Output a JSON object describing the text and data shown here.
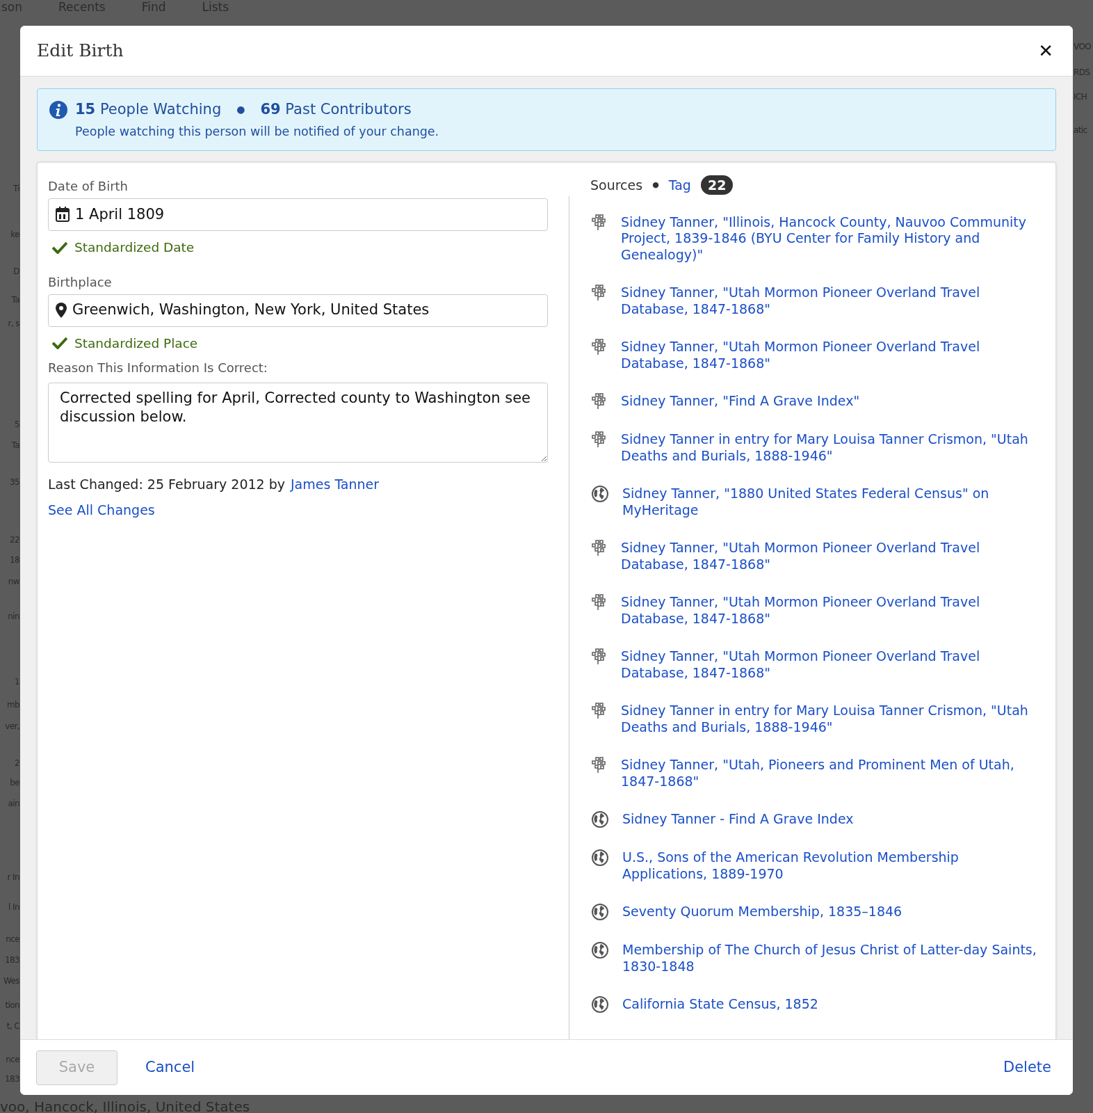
{
  "backdrop": {
    "nav": [
      "son",
      "Recents",
      "Find",
      "Lists"
    ],
    "left_fragments": [
      "Ti",
      "ke",
      "D",
      "Ta",
      "r, s",
      "5",
      "Ta",
      "35",
      "22",
      "18",
      "nw",
      "nin",
      "1",
      "mb",
      "ver,",
      "2",
      "be",
      "ain",
      "r In",
      "l In",
      "nce",
      "183",
      "Wes",
      "tion",
      "t, C",
      "nce",
      "183"
    ],
    "right_fragments": [
      "VOO",
      "RDS",
      "ICH",
      "atic"
    ],
    "bottom_text": "voo, Hancock, Illinois, United States"
  },
  "dialog": {
    "title": "Edit Birth",
    "close": "✕"
  },
  "notice": {
    "separator": "●",
    "watching_count": "15",
    "watching_label": "People Watching",
    "contributors_count": "69",
    "contributors_label": "Past Contributors",
    "message": "People watching this person will be notified of your change."
  },
  "date": {
    "label": "Date of Birth",
    "value": "1 April 1809",
    "status": "Standardized Date",
    "standardized": true
  },
  "place": {
    "label": "Birthplace",
    "value": "Greenwich, Washington, New York, United States",
    "status": "Standardized Place",
    "standardized": true
  },
  "reason": {
    "label": "Reason This Information Is Correct:",
    "value": "Corrected spelling for April, Corrected county to Washington see discussion below."
  },
  "last_changed": {
    "text": "Last Changed: 25 February 2012 by",
    "author": "James Tanner"
  },
  "see_all": "See All Changes",
  "sources_header": {
    "title": "Sources",
    "separator": "●",
    "tag": "Tag",
    "count": "22"
  },
  "sources": [
    {
      "kind": "tree",
      "text": "Sidney Tanner, \"Illinois, Hancock County, Nauvoo Community Project, 1839-1846 (BYU Center for Family History and Genealogy)\""
    },
    {
      "kind": "tree",
      "text": "Sidney Tanner, \"Utah Mormon Pioneer Overland Travel Database, 1847-1868\""
    },
    {
      "kind": "tree",
      "text": "Sidney Tanner, \"Utah Mormon Pioneer Overland Travel Database, 1847-1868\""
    },
    {
      "kind": "tree",
      "text": "Sidney Tanner, \"Find A Grave Index\""
    },
    {
      "kind": "tree",
      "text": "Sidney Tanner in entry for Mary Louisa Tanner Crismon, \"Utah Deaths and Burials, 1888-1946\""
    },
    {
      "kind": "globe",
      "text": "Sidney Tanner, \"1880 United States Federal Census\" on MyHeritage"
    },
    {
      "kind": "tree",
      "text": "Sidney Tanner, \"Utah Mormon Pioneer Overland Travel Database, 1847-1868\""
    },
    {
      "kind": "tree",
      "text": "Sidney Tanner, \"Utah Mormon Pioneer Overland Travel Database, 1847-1868\""
    },
    {
      "kind": "tree",
      "text": "Sidney Tanner, \"Utah Mormon Pioneer Overland Travel Database, 1847-1868\""
    },
    {
      "kind": "tree",
      "text": "Sidney Tanner in entry for Mary Louisa Tanner Crismon, \"Utah Deaths and Burials, 1888-1946\""
    },
    {
      "kind": "tree",
      "text": "Sidney Tanner, \"Utah, Pioneers and Prominent Men of Utah, 1847-1868\""
    },
    {
      "kind": "globe",
      "text": "Sidney Tanner - Find A Grave Index"
    },
    {
      "kind": "globe",
      "text": "U.S., Sons of the American Revolution Membership Applications, 1889-1970"
    },
    {
      "kind": "globe",
      "text": "Seventy Quorum Membership, 1835–1846"
    },
    {
      "kind": "globe",
      "text": "Membership of The Church of Jesus Christ of Latter-day Saints, 1830-1848"
    },
    {
      "kind": "globe",
      "text": "California State Census, 1852"
    }
  ],
  "footer": {
    "save": {
      "label": "Save",
      "disabled": true
    },
    "cancel": "Cancel",
    "delete": "Delete"
  }
}
